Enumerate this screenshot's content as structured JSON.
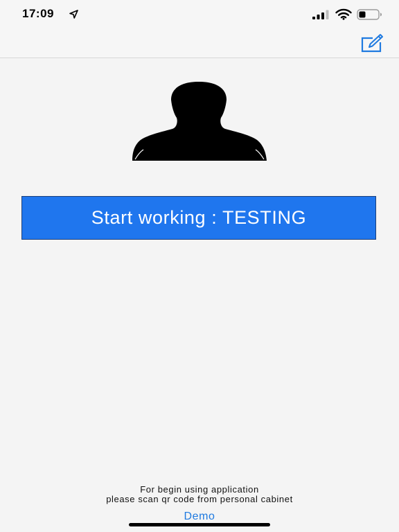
{
  "status_bar": {
    "time": "17:09",
    "icons": [
      "location-arrow-icon",
      "cellular-signal-icon",
      "wifi-icon",
      "battery-icon"
    ]
  },
  "nav_bar": {
    "compose_icon": "compose-icon"
  },
  "avatar": {
    "icon": "person-silhouette-icon"
  },
  "main": {
    "start_button_label": "Start working : TESTING"
  },
  "footer": {
    "line1": "For begin using application",
    "line2": "please scan qr code from personal cabinet",
    "demo_label": "Demo"
  },
  "colors": {
    "accent": "#1f76ee",
    "link": "#1f7ae0",
    "background": "#f4f4f4"
  }
}
